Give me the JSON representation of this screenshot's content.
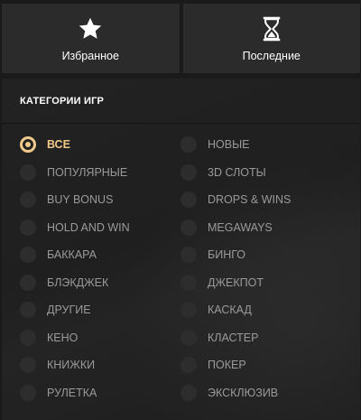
{
  "tiles": [
    {
      "label": "Избранное",
      "icon": "star-icon"
    },
    {
      "label": "Последние",
      "icon": "hourglass-icon"
    }
  ],
  "panel": {
    "title": "КАТЕГОРИИ ИГР",
    "selected": "ВСЕ",
    "accent_color": "#f1c98a",
    "categories": [
      "ВСЕ",
      "НОВЫЕ",
      "ПОПУЛЯРНЫЕ",
      "3D СЛОТЫ",
      "BUY BONUS",
      "DROPS & WINS",
      "HOLD AND WIN",
      "MEGAWAYS",
      "БАККАРА",
      "БИНГО",
      "БЛЭКДЖЕК",
      "ДЖЕКПОТ",
      "ДРУГИЕ",
      "КАСКАД",
      "КЕНО",
      "КЛАСТЕР",
      "КНИЖКИ",
      "ПОКЕР",
      "РУЛЕТКА",
      "ЭКСКЛЮЗИВ"
    ]
  }
}
